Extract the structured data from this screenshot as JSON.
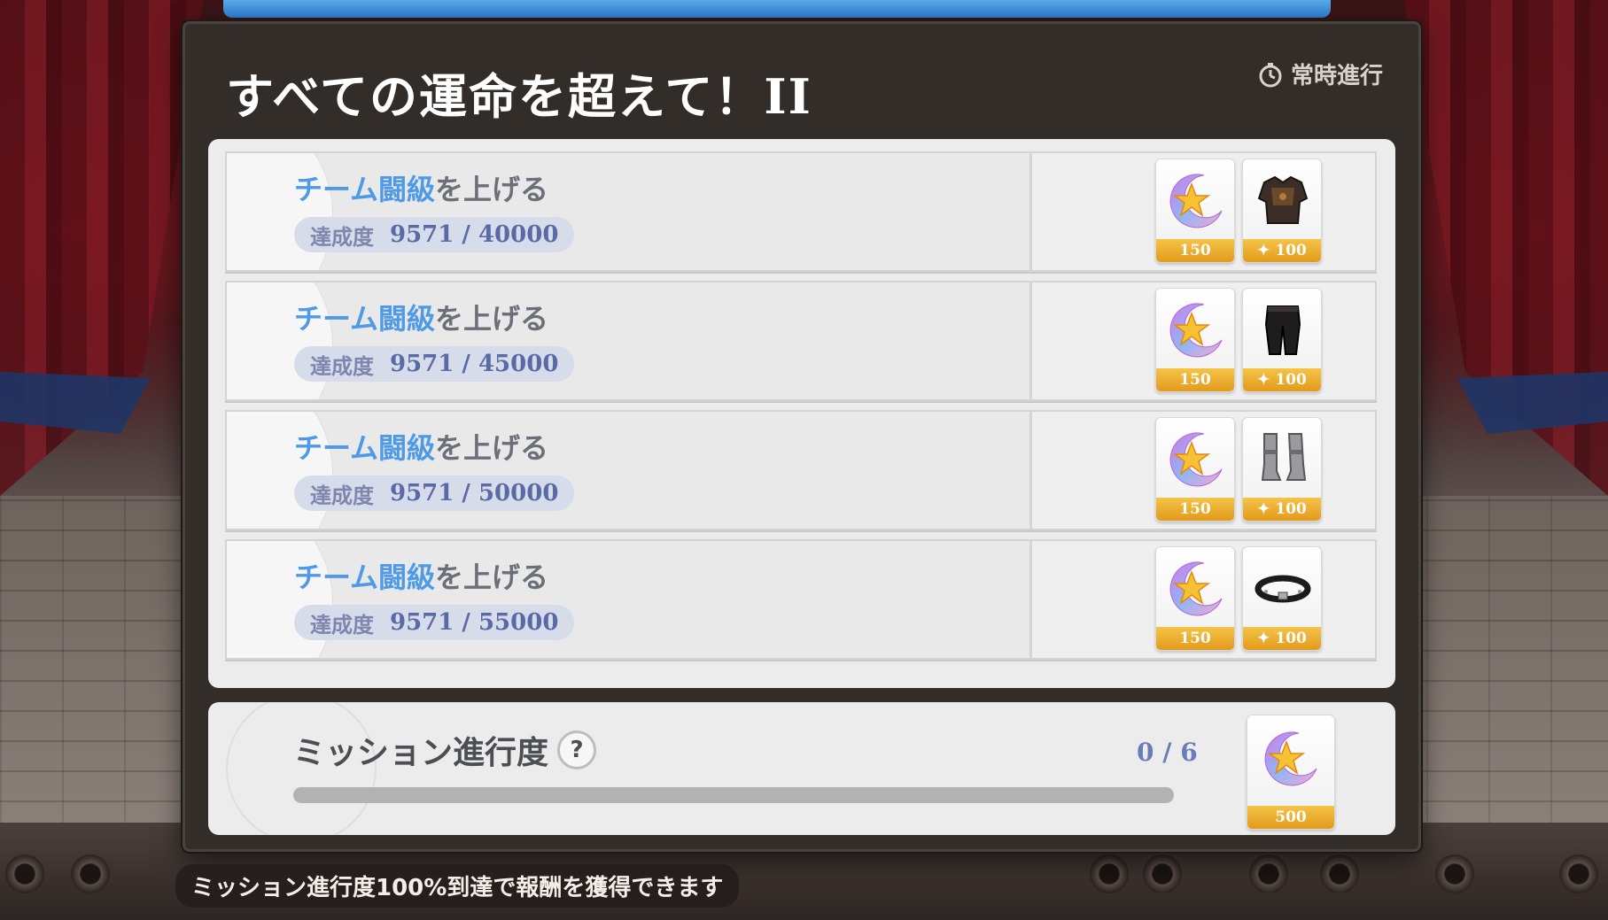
{
  "panel": {
    "title": "すべての運命を超えて！II",
    "status": "常時進行"
  },
  "missions": [
    {
      "title_highlight": "チーム闘級",
      "title_rest": "を上げる",
      "progress_label": "達成度",
      "progress_value": "9571 / 40000",
      "rewards": [
        {
          "icon": "star-crystal-icon",
          "qty": "150"
        },
        {
          "icon": "armor-chest-icon",
          "qty": "✦ 100"
        }
      ]
    },
    {
      "title_highlight": "チーム闘級",
      "title_rest": "を上げる",
      "progress_label": "達成度",
      "progress_value": "9571 / 45000",
      "rewards": [
        {
          "icon": "star-crystal-icon",
          "qty": "150"
        },
        {
          "icon": "armor-pants-icon",
          "qty": "✦ 100"
        }
      ]
    },
    {
      "title_highlight": "チーム闘級",
      "title_rest": "を上げる",
      "progress_label": "達成度",
      "progress_value": "9571 / 50000",
      "rewards": [
        {
          "icon": "star-crystal-icon",
          "qty": "150"
        },
        {
          "icon": "armor-boots-icon",
          "qty": "✦ 100"
        }
      ]
    },
    {
      "title_highlight": "チーム闘級",
      "title_rest": "を上げる",
      "progress_label": "達成度",
      "progress_value": "9571 / 55000",
      "rewards": [
        {
          "icon": "star-crystal-icon",
          "qty": "150"
        },
        {
          "icon": "armor-belt-icon",
          "qty": "✦ 100"
        }
      ]
    }
  ],
  "overall": {
    "label": "ミッション進行度",
    "help": "?",
    "count": "0 / 6",
    "fraction": 0,
    "reward": {
      "icon": "star-crystal-icon",
      "qty": "500"
    }
  },
  "footer": "ミッション進行度100%到達で報酬を獲得できます",
  "colors": {
    "highlight": "#4e9ae6",
    "reward_band": "#e9a52a",
    "panel_bg": "#332d2a"
  }
}
